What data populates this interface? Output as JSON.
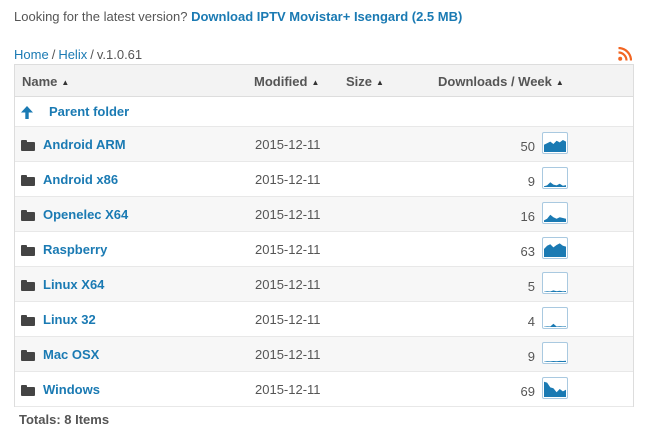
{
  "latest": {
    "prefix": "Looking for the latest version?",
    "link": "Download IPTV Movistar+ Isengard (2.5 MB)"
  },
  "breadcrumb": {
    "home": "Home",
    "sep": "/",
    "section": "Helix",
    "current": "v.1.0.61"
  },
  "rss_icon": "rss-feed-icon",
  "table": {
    "columns": {
      "name": "Name",
      "modified": "Modified",
      "size": "Size",
      "downloads": "Downloads / Week"
    },
    "sort_icon": "sort-arrows-icon",
    "parent": {
      "icon": "arrow-up-icon",
      "label": "Parent folder"
    },
    "folder_icon": "folder-icon",
    "rows": [
      {
        "name": "Android ARM",
        "modified": "2015-12-11",
        "downloads": "50",
        "trend": [
          0.45,
          0.55,
          0.65,
          0.5,
          0.7,
          0.6,
          0.75,
          0.65
        ]
      },
      {
        "name": "Android x86",
        "modified": "2015-12-11",
        "downloads": "9",
        "trend": [
          0.05,
          0.1,
          0.3,
          0.15,
          0.1,
          0.2,
          0.08,
          0.12
        ]
      },
      {
        "name": "Openelec X64",
        "modified": "2015-12-11",
        "downloads": "16",
        "trend": [
          0.1,
          0.2,
          0.45,
          0.3,
          0.2,
          0.3,
          0.25,
          0.2
        ]
      },
      {
        "name": "Raspberry",
        "modified": "2015-12-11",
        "downloads": "63",
        "trend": [
          0.5,
          0.7,
          0.8,
          0.6,
          0.75,
          0.85,
          0.7,
          0.65
        ]
      },
      {
        "name": "Linux X64",
        "modified": "2015-12-11",
        "downloads": "5",
        "trend": [
          0.02,
          0.05,
          0.03,
          0.1,
          0.05,
          0.08,
          0.04,
          0.06
        ]
      },
      {
        "name": "Linux 32",
        "modified": "2015-12-11",
        "downloads": "4",
        "trend": [
          0.02,
          0.04,
          0.03,
          0.2,
          0.03,
          0.05,
          0.03,
          0.04
        ]
      },
      {
        "name": "Mac OSX",
        "modified": "2015-12-11",
        "downloads": "9",
        "trend": [
          0.02,
          0.05,
          0.04,
          0.06,
          0.05,
          0.07,
          0.06,
          0.08
        ]
      },
      {
        "name": "Windows",
        "modified": "2015-12-11",
        "downloads": "69",
        "trend": [
          0.95,
          0.9,
          0.6,
          0.55,
          0.3,
          0.5,
          0.35,
          0.45
        ]
      }
    ]
  },
  "totals": "Totals: 8 Items",
  "colors": {
    "link": "#1a7ab3",
    "spark_fill": "#1a7ab3",
    "spark_border": "#a9c9e0",
    "header_bg": "#f3f3f3",
    "alt_row_bg": "#f7f7f7"
  }
}
